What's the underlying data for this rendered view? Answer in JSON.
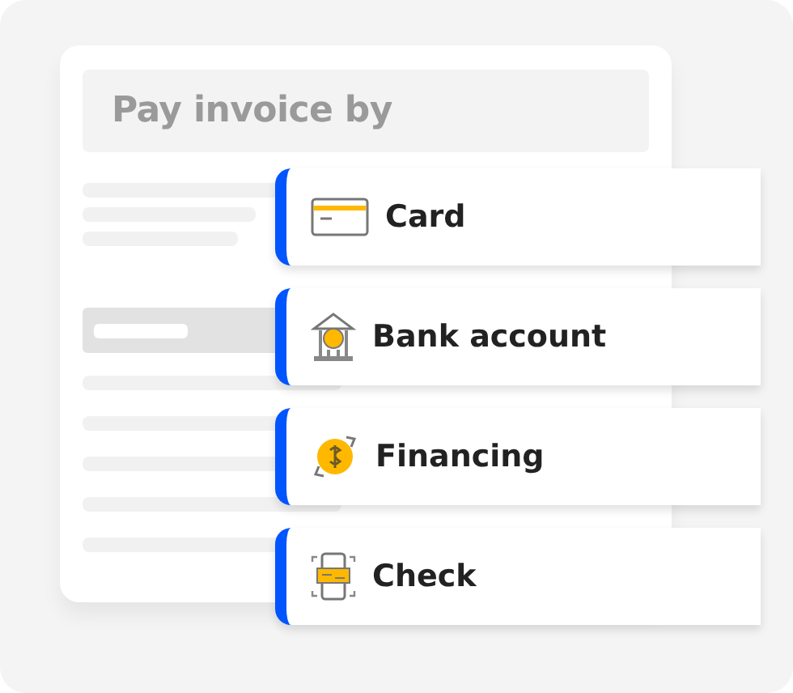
{
  "form": {
    "title": "Pay invoice by"
  },
  "options": [
    {
      "label": "Card",
      "kind": "card"
    },
    {
      "label": "Bank account",
      "kind": "bank"
    },
    {
      "label": "Financing",
      "kind": "financing"
    },
    {
      "label": "Check",
      "kind": "check"
    }
  ]
}
